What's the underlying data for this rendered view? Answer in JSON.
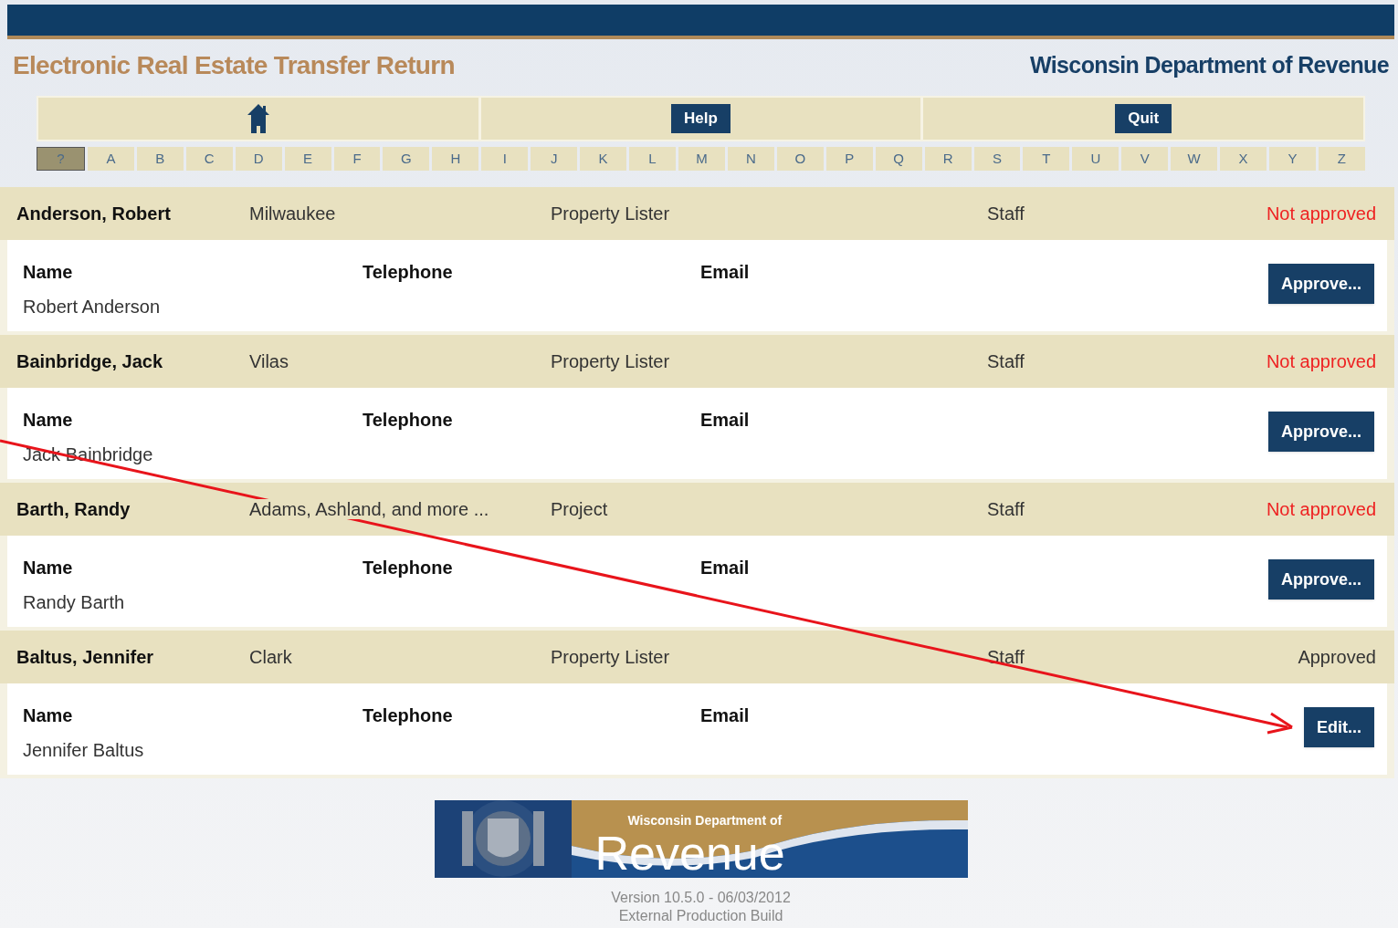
{
  "header": {
    "title": "Electronic Real Estate Transfer Return",
    "agency": "Wisconsin Department of Revenue"
  },
  "nav": {
    "buttons": [
      "Help",
      "Quit"
    ]
  },
  "letters": [
    {
      "label": "?",
      "selected": true
    },
    {
      "label": "A",
      "selected": false
    },
    {
      "label": "B",
      "selected": false
    },
    {
      "label": "C",
      "selected": false
    },
    {
      "label": "D",
      "selected": false
    },
    {
      "label": "E",
      "selected": false
    },
    {
      "label": "F",
      "selected": false
    },
    {
      "label": "G",
      "selected": false
    },
    {
      "label": "H",
      "selected": false
    },
    {
      "label": "I",
      "selected": false
    },
    {
      "label": "J",
      "selected": false
    },
    {
      "label": "K",
      "selected": false
    },
    {
      "label": "L",
      "selected": false
    },
    {
      "label": "M",
      "selected": false
    },
    {
      "label": "N",
      "selected": false
    },
    {
      "label": "O",
      "selected": false
    },
    {
      "label": "P",
      "selected": false
    },
    {
      "label": "Q",
      "selected": false
    },
    {
      "label": "R",
      "selected": false
    },
    {
      "label": "S",
      "selected": false
    },
    {
      "label": "T",
      "selected": false
    },
    {
      "label": "U",
      "selected": false
    },
    {
      "label": "V",
      "selected": false
    },
    {
      "label": "W",
      "selected": false
    },
    {
      "label": "X",
      "selected": false
    },
    {
      "label": "Y",
      "selected": false
    },
    {
      "label": "Z",
      "selected": false
    }
  ],
  "records": [
    {
      "name": "Anderson, Robert",
      "county": "Milwaukee",
      "role": "Property Lister",
      "type": "Staff",
      "status": "Not approved",
      "approved": false,
      "labels": [
        "Name",
        "Telephone",
        "Email"
      ],
      "full_name": "Robert Anderson",
      "action": "Approve..."
    },
    {
      "name": "Bainbridge, Jack",
      "county": "Vilas",
      "role": "Property Lister",
      "type": "Staff",
      "status": "Not approved",
      "approved": false,
      "labels": [
        "Name",
        "Telephone",
        "Email"
      ],
      "full_name": "Jack Bainbridge",
      "action": "Approve..."
    },
    {
      "name": "Barth, Randy",
      "county": "Adams, Ashland, and more ...",
      "role": "Project",
      "type": "Staff",
      "status": "Not approved",
      "approved": false,
      "labels": [
        "Name",
        "Telephone",
        "Email"
      ],
      "full_name": "Randy Barth",
      "action": "Approve..."
    },
    {
      "name": "Baltus, Jennifer",
      "county": "Clark",
      "role": "Property Lister",
      "type": "Staff",
      "status": "Approved",
      "approved": true,
      "labels": [
        "Name",
        "Telephone",
        "Email"
      ],
      "full_name": "Jennifer Baltus",
      "action": "Edit..."
    }
  ],
  "footer": {
    "banner_line": "Wisconsin Department of",
    "banner_word": "Revenue",
    "version": "Version 10.5.0 - 06/03/2012",
    "build": "External Production Build"
  }
}
